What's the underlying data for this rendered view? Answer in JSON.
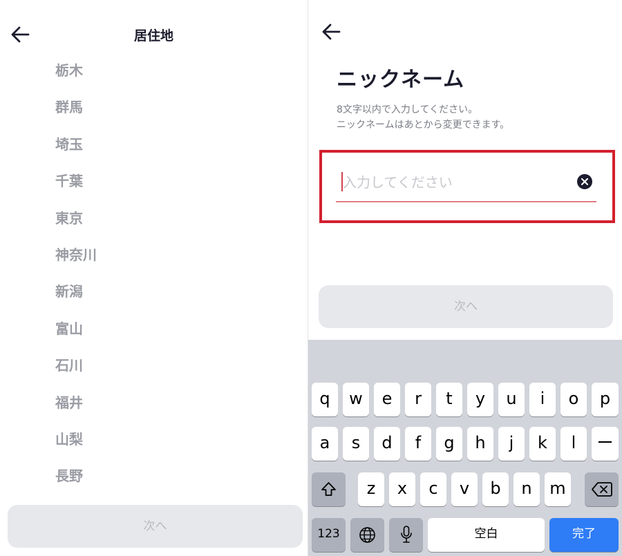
{
  "left_screen": {
    "title": "居住地",
    "prefectures": [
      "栃木",
      "群馬",
      "埼玉",
      "千葉",
      "東京",
      "神奈川",
      "新潟",
      "富山",
      "石川",
      "福井",
      "山梨",
      "長野"
    ],
    "next_label": "次へ"
  },
  "right_screen": {
    "heading": "ニックネーム",
    "desc_line1": "8文字以内で入力してください。",
    "desc_line2": "ニックネームはあとから変更できます。",
    "input_placeholder": "入力してください",
    "input_value": "",
    "next_label": "次へ"
  },
  "keyboard": {
    "row1": [
      "q",
      "w",
      "e",
      "r",
      "t",
      "y",
      "u",
      "i",
      "o",
      "p"
    ],
    "row2": [
      "a",
      "s",
      "d",
      "f",
      "g",
      "h",
      "j",
      "k",
      "l",
      "ー"
    ],
    "row3": [
      "z",
      "x",
      "c",
      "v",
      "b",
      "n",
      "m"
    ],
    "numbers_label": "123",
    "space_label": "空白",
    "done_label": "完了"
  },
  "colors": {
    "highlight_border": "#d3202f",
    "done_key": "#2e7cf6",
    "disabled_button": "#e7e8ec",
    "keyboard_bg": "#d1d4da"
  },
  "icons": {
    "back": "arrow-left-icon",
    "clear": "clear-x-circle-icon",
    "shift": "shift-arrow-icon",
    "backspace": "backspace-icon",
    "globe": "globe-icon",
    "mic": "microphone-icon"
  }
}
